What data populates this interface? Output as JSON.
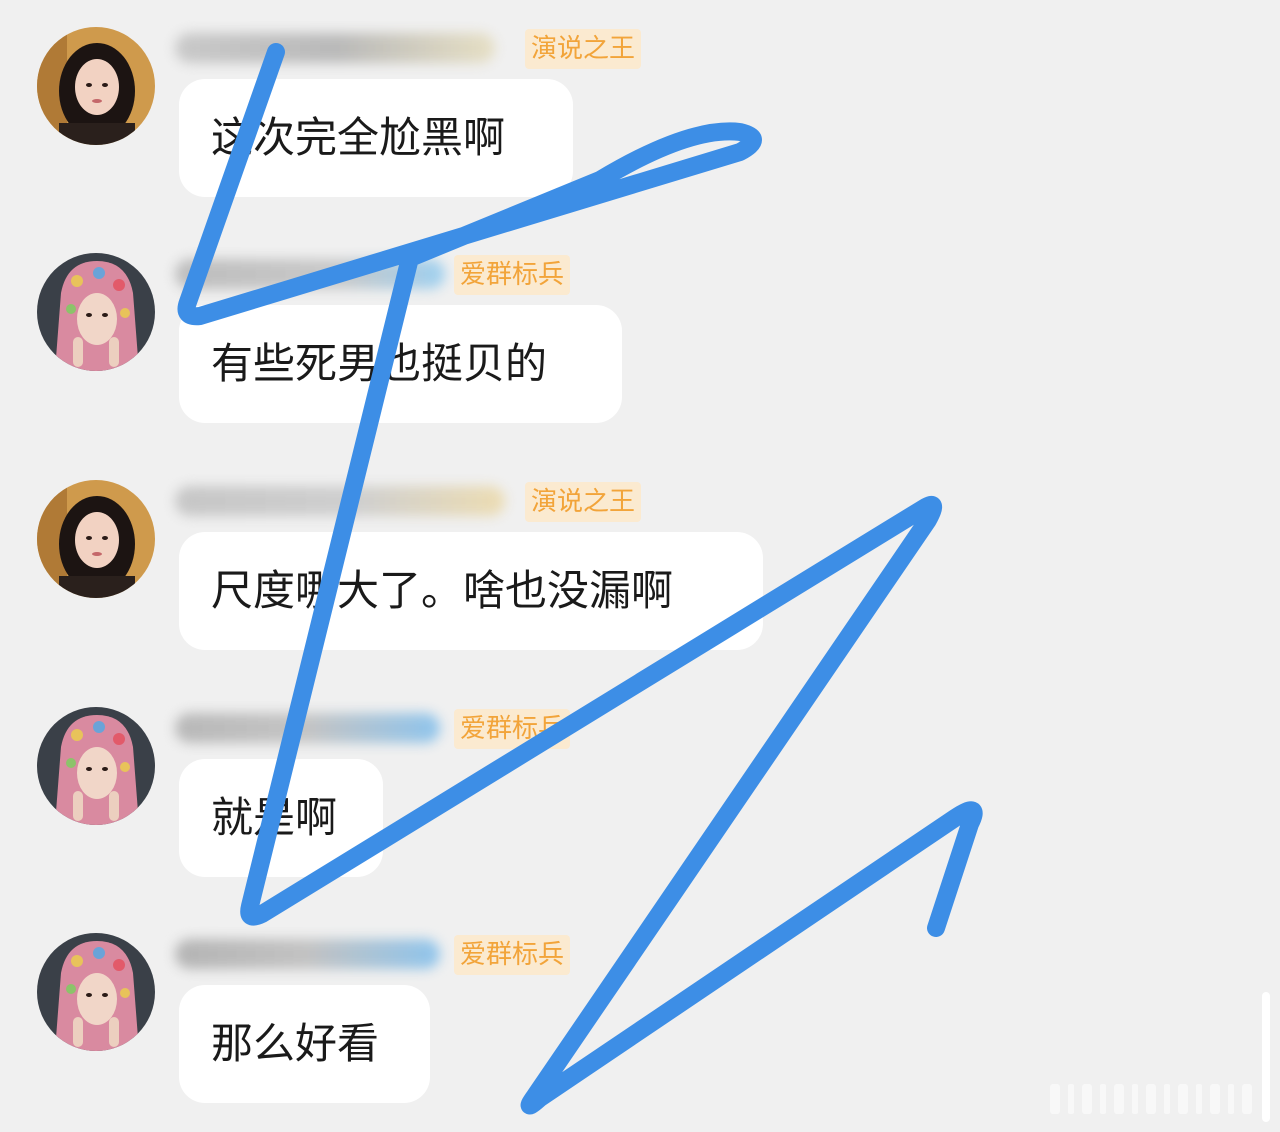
{
  "messages": [
    {
      "avatar_style": "portrait",
      "badge": "演说之王",
      "text": "这次完全尬黑啊"
    },
    {
      "avatar_style": "knit-hood",
      "badge": "爱群标兵",
      "text": "有些死男也挺贝的"
    },
    {
      "avatar_style": "portrait",
      "badge": "演说之王",
      "text": "尺度哪大了。啥也没漏啊"
    },
    {
      "avatar_style": "knit-hood",
      "badge": "爱群标兵",
      "text": "就是啊"
    },
    {
      "avatar_style": "knit-hood",
      "badge": "爱群标兵",
      "text": "那么好看"
    }
  ],
  "colors": {
    "background": "#f0f0f0",
    "bubble": "#ffffff",
    "badge_text": "#f2a43a",
    "badge_bg": "#fbead0",
    "scribble": "#3d8ee6"
  },
  "overlay": {
    "type": "hand-drawn zigzag scribble",
    "color": "#3d8ee6"
  }
}
